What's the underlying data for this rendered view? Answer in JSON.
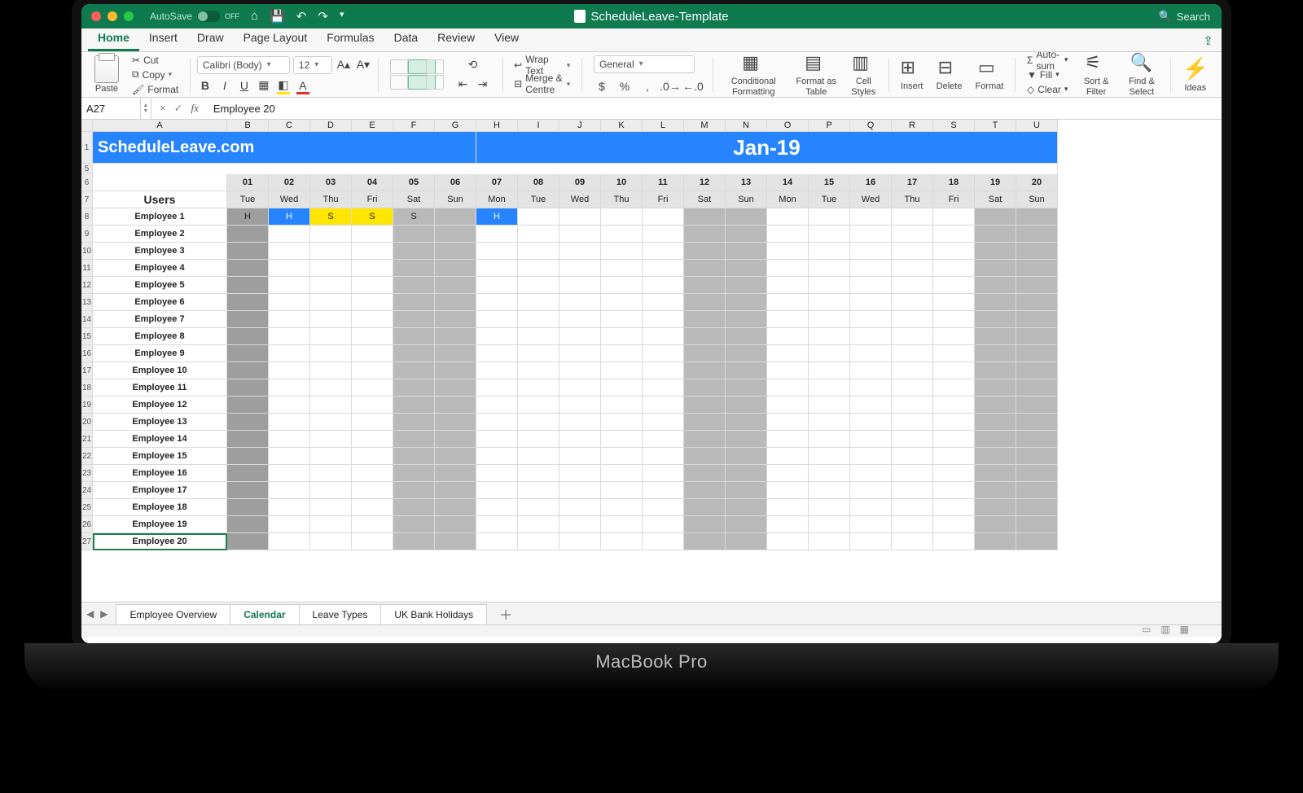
{
  "laptop_label": "MacBook Pro",
  "titlebar": {
    "autosave_label": "AutoSave",
    "autosave_state": "OFF",
    "doc_name": "ScheduleLeave-Template",
    "search_placeholder": "Search"
  },
  "menu": {
    "tabs": [
      "Home",
      "Insert",
      "Draw",
      "Page Layout",
      "Formulas",
      "Data",
      "Review",
      "View"
    ],
    "active": "Home"
  },
  "ribbon": {
    "paste": "Paste",
    "cut": "Cut",
    "copy": "Copy",
    "format_painter": "Format",
    "font_name": "Calibri (Body)",
    "font_size": "12",
    "wrap": "Wrap Text",
    "merge": "Merge & Centre",
    "num_format": "General",
    "cond": "Conditional\nFormatting",
    "fmt_tbl": "Format\nas Table",
    "styles": "Cell\nStyles",
    "insert": "Insert",
    "delete": "Delete",
    "format": "Format",
    "autosum": "Auto-sum",
    "fill": "Fill",
    "clear": "Clear",
    "sort": "Sort &\nFilter",
    "find": "Find &\nSelect",
    "ideas": "Ideas"
  },
  "formula": {
    "cell_ref": "A27",
    "value": "Employee 20"
  },
  "columns": [
    "A",
    "B",
    "C",
    "D",
    "E",
    "F",
    "G",
    "H",
    "I",
    "J",
    "K",
    "L",
    "M",
    "N",
    "O",
    "P",
    "Q",
    "R",
    "S",
    "T",
    "U"
  ],
  "header": {
    "title": "ScheduleLeave.com",
    "month": "Jan-19"
  },
  "users_label": "Users",
  "days": [
    {
      "num": "01",
      "dow": "Tue",
      "ph": true
    },
    {
      "num": "02",
      "dow": "Wed"
    },
    {
      "num": "03",
      "dow": "Thu"
    },
    {
      "num": "04",
      "dow": "Fri"
    },
    {
      "num": "05",
      "dow": "Sat",
      "wk": true
    },
    {
      "num": "06",
      "dow": "Sun",
      "wk": true
    },
    {
      "num": "07",
      "dow": "Mon"
    },
    {
      "num": "08",
      "dow": "Tue"
    },
    {
      "num": "09",
      "dow": "Wed"
    },
    {
      "num": "10",
      "dow": "Thu"
    },
    {
      "num": "11",
      "dow": "Fri"
    },
    {
      "num": "12",
      "dow": "Sat",
      "wk": true
    },
    {
      "num": "13",
      "dow": "Sun",
      "wk": true
    },
    {
      "num": "14",
      "dow": "Mon"
    },
    {
      "num": "15",
      "dow": "Tue"
    },
    {
      "num": "16",
      "dow": "Wed"
    },
    {
      "num": "17",
      "dow": "Thu"
    },
    {
      "num": "18",
      "dow": "Fri"
    },
    {
      "num": "19",
      "dow": "Sat",
      "wk": true
    },
    {
      "num": "20",
      "dow": "Sun",
      "wk": true
    }
  ],
  "employees": [
    "Employee 1",
    "Employee 2",
    "Employee 3",
    "Employee 4",
    "Employee 5",
    "Employee 6",
    "Employee 7",
    "Employee 8",
    "Employee 9",
    "Employee 10",
    "Employee 11",
    "Employee 12",
    "Employee 13",
    "Employee 14",
    "Employee 15",
    "Employee 16",
    "Employee 17",
    "Employee 18",
    "Employee 19",
    "Employee 20"
  ],
  "leave": {
    "0": {
      "0": "H",
      "1": "H",
      "2": "S",
      "3": "S",
      "4": "S",
      "6": "H"
    }
  },
  "leave_class": {
    "0": {
      "0": "ph",
      "1": "lH",
      "2": "lS",
      "3": "lS",
      "4": "wk",
      "6": "lH"
    }
  },
  "row_start": 8,
  "sheet_tabs": [
    "Employee Overview",
    "Calendar",
    "Leave Types",
    "UK Bank Holidays"
  ],
  "sheet_active": "Calendar"
}
